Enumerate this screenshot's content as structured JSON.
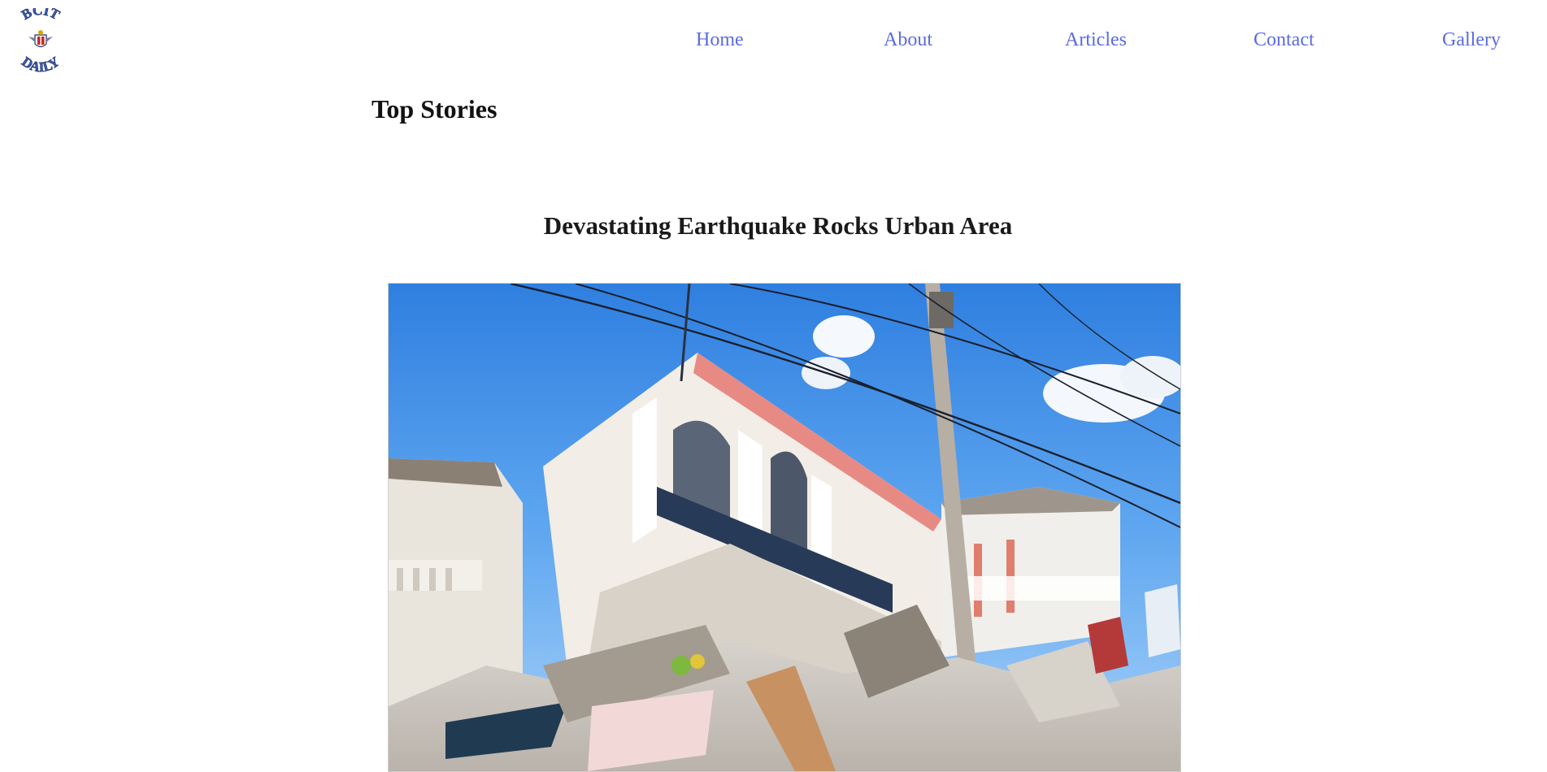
{
  "header": {
    "logo": {
      "text_top": "BCIT",
      "text_bottom": "DAILY",
      "icon": "shield-logo-icon"
    },
    "nav": [
      {
        "label": "Home"
      },
      {
        "label": "About"
      },
      {
        "label": "Articles"
      },
      {
        "label": "Contact"
      },
      {
        "label": "Gallery"
      }
    ],
    "nav_color": "#5b6be0"
  },
  "main": {
    "section_title": "Top Stories",
    "article": {
      "title": "Devastating Earthquake Rocks Urban Area",
      "image_icon": "earthquake-collapsed-building-photo"
    }
  }
}
